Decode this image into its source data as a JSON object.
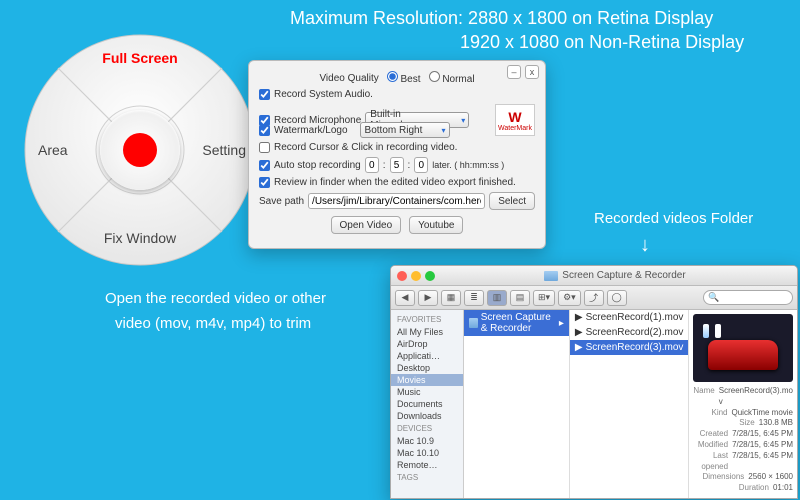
{
  "headlines": {
    "line1": "Maximum Resolution:  2880 x 1800  on Retina Display",
    "line2": "1920 x 1080  on Non-Retina Display"
  },
  "radial": {
    "top": "Full Screen",
    "right": "Setting",
    "bottom": "Fix Window",
    "left": "Area"
  },
  "panel": {
    "quality_label": "Video Quality",
    "best": "Best",
    "normal": "Normal",
    "opt_audio": "Record System Audio.",
    "opt_mic": "Record Microphone",
    "mic_value": "Built-in Microphone",
    "opt_wm": "Watermark/Logo",
    "wm_value": "Bottom Right",
    "wm_badge": "WaterMark",
    "opt_cursor": "Record Cursor & Click in recording video.",
    "opt_autostop": "Auto stop recording",
    "autostop_h": "0",
    "autostop_m": "5",
    "autostop_s": "0",
    "autostop_suffix": "later.  ( hh:mm:ss )",
    "opt_review": "Review in finder when the edited video export finished.",
    "savepath_label": "Save path",
    "savepath_value": "/Users/jim/Library/Containers/com.heron.screenca",
    "select_btn": "Select",
    "open_btn": "Open Video",
    "youtube_btn": "Youtube"
  },
  "explain1a": "Open the recorded video or other",
  "explain1b": "video (mov, m4v, mp4) to trim",
  "explain2": "Recorded videos Folder",
  "finder": {
    "title": "Screen Capture & Recorder",
    "sidebar_headers": {
      "fav": "FAVORITES",
      "dev": "DEVICES",
      "tags": "TAGS"
    },
    "favorites": [
      "All My Files",
      "AirDrop",
      "Applicati…",
      "Desktop",
      "Movies",
      "Music",
      "Documents",
      "Downloads"
    ],
    "devices": [
      "Mac 10.9",
      "Mac 10.10",
      "Remote…"
    ],
    "col1": "Screen Capture & Recorder",
    "files": [
      "ScreenRecord(1).mov",
      "ScreenRecord(2).mov",
      "ScreenRecord(3).mov"
    ],
    "meta": {
      "Name": "ScreenRecord(3).mo v",
      "Kind": "QuickTime movie",
      "Size": "130.8 MB",
      "Created": "7/28/15, 6:45 PM",
      "Modified": "7/28/15, 6:45 PM",
      "Last opened": "7/28/15, 6:45 PM",
      "Dimensions": "2560 × 1600",
      "Duration": "01:01"
    }
  }
}
